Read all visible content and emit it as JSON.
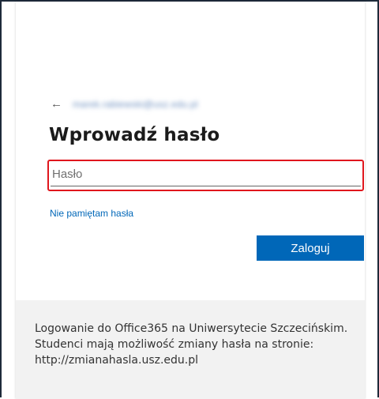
{
  "identity": {
    "back_icon": "arrow-left-icon",
    "back_glyph": "←",
    "email": "marek.rabiewski@usz.edu.pl"
  },
  "title": "Wprowadź hasło",
  "password": {
    "placeholder": "Hasło",
    "value": "",
    "highlight_color": "#e0161d"
  },
  "forgot_link": "Nie pamiętam hasła",
  "signin_button": "Zaloguj",
  "footer": {
    "text": "Logowanie do Office365 na Uniwersytecie Szczecińskim. Studenci mają możliwość zmiany hasła na stronie: http://zmianahasla.usz.edu.pl"
  },
  "colors": {
    "accent": "#0067b8",
    "footer_bg": "#f2f2f2"
  }
}
